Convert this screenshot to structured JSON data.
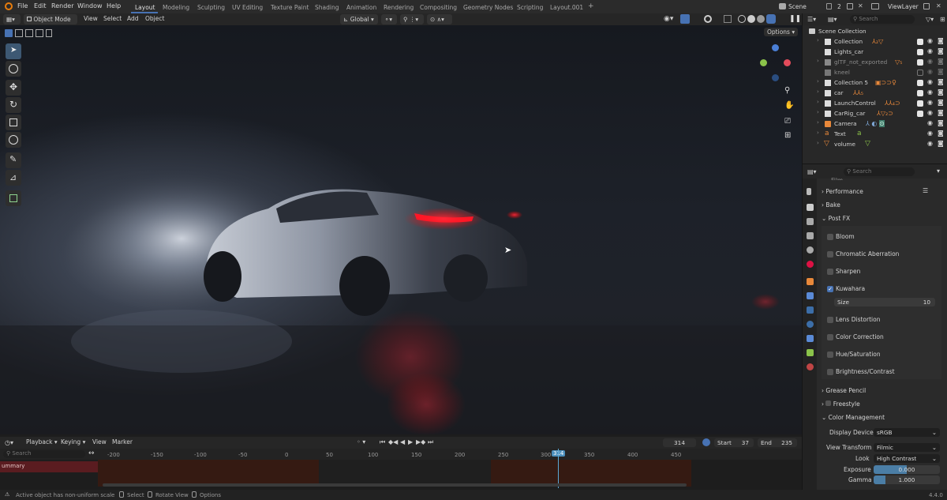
{
  "app": {
    "menus": [
      "File",
      "Edit",
      "Render",
      "Window",
      "Help"
    ]
  },
  "workspaces": [
    "Layout",
    "Modeling",
    "Sculpting",
    "UV Editing",
    "Texture Paint",
    "Shading",
    "Animation",
    "Rendering",
    "Compositing",
    "Geometry Nodes",
    "Scripting",
    "Layout.001"
  ],
  "active_workspace": "Layout",
  "scene": {
    "name": "Scene",
    "view_layer": "ViewLayer",
    "users": "2"
  },
  "viewport_header": {
    "mode": "Object Mode",
    "menus": [
      "View",
      "Select",
      "Add",
      "Object"
    ],
    "transform_orientation": "Global",
    "options_label": "Options"
  },
  "outliner": {
    "search_placeholder": "Search",
    "root": "Scene Collection",
    "items": [
      {
        "name": "Collection",
        "count": "2"
      },
      {
        "name": "Lights_car",
        "count": ""
      },
      {
        "name": "glTF_not_exported",
        "count": "5"
      },
      {
        "name": "kneel",
        "count": ""
      },
      {
        "name": "Collection 5",
        "count": ""
      },
      {
        "name": "car",
        "count": "5"
      },
      {
        "name": "LaunchControl",
        "count": "4"
      },
      {
        "name": "CarRig_car",
        "count": "2"
      },
      {
        "name": "Camera",
        "count": ""
      },
      {
        "name": "Text",
        "count": ""
      },
      {
        "name": "volume",
        "count": ""
      }
    ]
  },
  "properties": {
    "search_placeholder": "Search",
    "film_label": "Film",
    "sections": {
      "performance": "Performance",
      "bake": "Bake",
      "post_fx": "Post FX",
      "grease_pencil": "Grease Pencil",
      "freestyle": "Freestyle",
      "color_management": "Color Management"
    },
    "post_fx": [
      {
        "label": "Bloom",
        "checked": false
      },
      {
        "label": "Chromatic Aberration",
        "checked": false
      },
      {
        "label": "Sharpen",
        "checked": false
      },
      {
        "label": "Kuwahara",
        "checked": true
      },
      {
        "label": "Lens Distortion",
        "checked": false
      },
      {
        "label": "Color Correction",
        "checked": false
      },
      {
        "label": "Hue/Saturation",
        "checked": false
      },
      {
        "label": "Brightness/Contrast",
        "checked": false
      }
    ],
    "kuwahara_size_label": "Size",
    "kuwahara_size_value": "10",
    "color_management": {
      "display_device_label": "Display Device",
      "display_device": "sRGB",
      "view_transform_label": "View Transform",
      "view_transform": "Filmic",
      "look_label": "Look",
      "look": "High Contrast",
      "exposure_label": "Exposure",
      "exposure": "0.000",
      "gamma_label": "Gamma",
      "gamma": "1.000"
    }
  },
  "timeline": {
    "menus": [
      "Playback",
      "Keying",
      "View",
      "Marker"
    ],
    "current_frame": "314",
    "start_label": "Start",
    "start": "37",
    "end_label": "End",
    "end": "235",
    "search_placeholder": "Search",
    "summary_label": "ummary",
    "ticks": [
      "-200",
      "-150",
      "-100",
      "-50",
      "0",
      "50",
      "100",
      "150",
      "200",
      "250",
      "300",
      "350",
      "400",
      "450"
    ],
    "playhead_label": "314"
  },
  "status": {
    "message": "Active object has non-uniform scale",
    "hints": [
      "Select",
      "Rotate View",
      "Options"
    ],
    "version": "4.4.0"
  },
  "colors": {
    "accent": "#4772b3",
    "taillight": "#ff1a2e",
    "playhead": "#5aa8d6"
  }
}
